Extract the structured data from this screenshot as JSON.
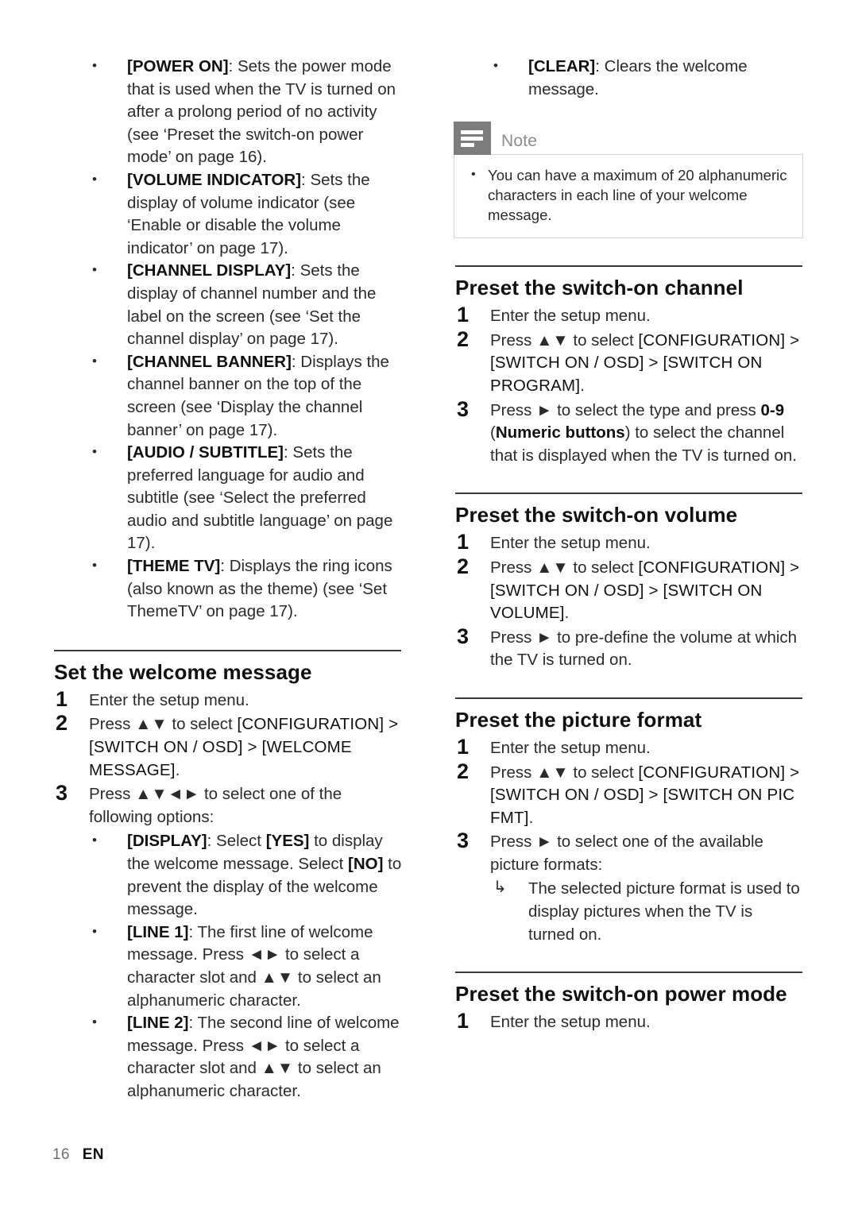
{
  "page": {
    "footer_page_number": "16",
    "footer_language": "EN"
  },
  "left_column": {
    "bullets": [
      {
        "term": "[POWER ON]",
        "text": ": Sets the power mode that is used when the TV is turned on after a prolong period of no activity (see ‘Preset the switch-on power mode’ on page 16)."
      },
      {
        "term": "[VOLUME INDICATOR]",
        "text": ": Sets the display of volume indicator (see ‘Enable or disable the volume indicator’ on page 17)."
      },
      {
        "term": "[CHANNEL DISPLAY]",
        "text": ": Sets the display of channel number and the label on the screen (see ‘Set the channel display’ on page 17)."
      },
      {
        "term": "[CHANNEL BANNER]",
        "text": ": Displays the channel banner on the top of the screen (see ‘Display the channel banner’ on page 17)."
      },
      {
        "term": "[AUDIO / SUBTITLE]",
        "text": ": Sets the preferred language for audio and subtitle (see ‘Select the preferred audio and subtitle language’ on page 17)."
      },
      {
        "term": "[THEME TV]",
        "text": ": Displays the ring icons (also known as the theme) (see ‘Set ThemeTV’ on page 17)."
      }
    ],
    "welcome_section": {
      "heading": "Set the welcome message",
      "step1": {
        "num": "1",
        "text": "Enter the setup menu."
      },
      "step2": {
        "num": "2",
        "pre": "Press ▲▼ to select ",
        "path": "[CONFIGURATION] > [SWITCH ON / OSD] > [WELCOME MESSAGE]",
        "post": "."
      },
      "step3": {
        "num": "3",
        "text": "Press ▲▼◄► to select one of the following options:"
      },
      "options": [
        {
          "term": "[DISPLAY]",
          "seg1": ": Select ",
          "kw1": "[YES]",
          "seg2": " to display the welcome message. Select ",
          "kw2": "[NO]",
          "seg3": " to prevent the display of the welcome message."
        },
        {
          "term": "[LINE 1]",
          "seg1": ": The first line of welcome message. Press ◄► to select a character slot and ▲▼ to select an alphanumeric character."
        },
        {
          "term": "[LINE 2]",
          "seg1": ": The second line of welcome message. Press ◄► to select a character slot and ▲▼ to select an alphanumeric character."
        }
      ]
    }
  },
  "right_column": {
    "clear_bullet": {
      "term": "[CLEAR]",
      "text": ": Clears the welcome message."
    },
    "note": {
      "icon": "note-lines-icon",
      "title": "Note",
      "items": [
        "You can have a maximum of 20 alphanumeric characters in each line of your welcome message."
      ],
      "tab_color": "#7d7d7d",
      "border_color": "#cfd4d6"
    },
    "sections": [
      {
        "heading": "Preset the switch-on channel",
        "steps": [
          {
            "num": "1",
            "text": "Enter the setup menu."
          },
          {
            "num": "2",
            "pre": "Press ▲▼ to select ",
            "path": "[CONFIGURATION] > [SWITCH ON / OSD] > [SWITCH ON PROGRAM]",
            "post": "."
          },
          {
            "num": "3",
            "pre": "Press ► to select the type and press ",
            "bold1": "0-9",
            "mid": " (",
            "bold2": "Numeric buttons",
            "post": ") to select the channel that is displayed when the TV is turned on."
          }
        ]
      },
      {
        "heading": "Preset the switch-on volume",
        "steps": [
          {
            "num": "1",
            "text": "Enter the setup menu."
          },
          {
            "num": "2",
            "pre": "Press ▲▼ to select ",
            "path": "[CONFIGURATION] > [SWITCH ON / OSD] > [SWITCH ON VOLUME]",
            "post": "."
          },
          {
            "num": "3",
            "text": "Press ► to pre-define the volume at which the TV is turned on."
          }
        ]
      },
      {
        "heading": "Preset the picture format",
        "steps": [
          {
            "num": "1",
            "text": "Enter the setup menu."
          },
          {
            "num": "2",
            "pre": "Press ▲▼ to select ",
            "path": "[CONFIGURATION] > [SWITCH ON / OSD] > [SWITCH ON PIC FMT]",
            "post": "."
          },
          {
            "num": "3",
            "text": "Press ► to select one of the available picture formats:"
          }
        ],
        "arrow_item": "The selected picture format is used to display pictures when the TV is turned on."
      },
      {
        "heading": "Preset the switch-on power mode",
        "steps": [
          {
            "num": "1",
            "text": "Enter the setup menu."
          }
        ]
      }
    ]
  }
}
